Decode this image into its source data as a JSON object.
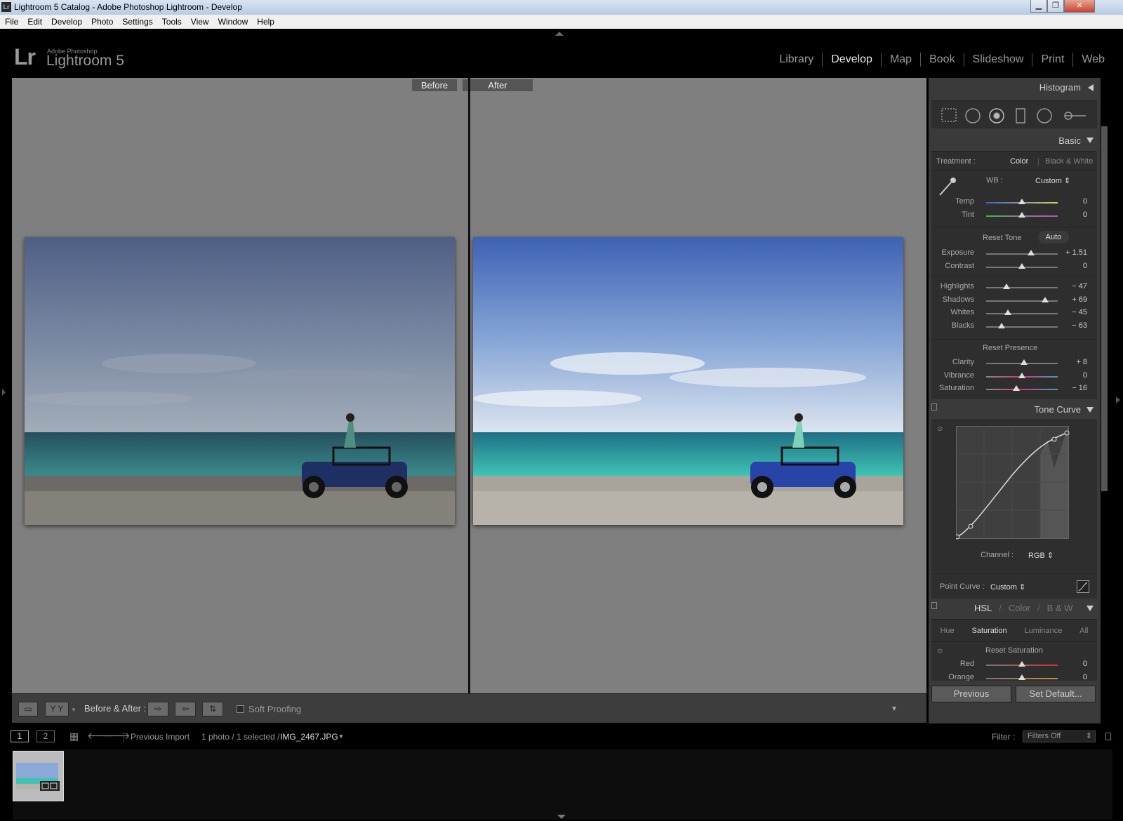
{
  "window": {
    "title": "Lightroom 5 Catalog - Adobe Photoshop Lightroom - Develop",
    "icon_label": "Lr",
    "min_icon": "minimize-icon",
    "max_icon": "maximize-icon",
    "close_icon": "close-icon"
  },
  "menu": [
    "File",
    "Edit",
    "Develop",
    "Photo",
    "Settings",
    "Tools",
    "View",
    "Window",
    "Help"
  ],
  "identity": {
    "logo": "Lr",
    "brand": "Adobe Photoshop",
    "product": "Lightroom 5"
  },
  "modules": [
    "Library",
    "Develop",
    "Map",
    "Book",
    "Slideshow",
    "Print",
    "Web"
  ],
  "active_module": "Develop",
  "compare": {
    "before_label": "Before",
    "after_label": "After"
  },
  "toolbar": {
    "before_after_label": "Before & After :",
    "soft_proofing": "Soft Proofing",
    "yy_label": "Y Y"
  },
  "panels": {
    "histogram": "Histogram",
    "basic": {
      "title": "Basic",
      "treatment_label": "Treatment :",
      "treatment_color": "Color",
      "treatment_bw": "Black & White",
      "wb_label": "WB :",
      "wb_value": "Custom",
      "reset_tone": "Reset Tone",
      "auto": "Auto",
      "reset_presence": "Reset Presence",
      "wb_sliders": [
        {
          "label": "Temp",
          "value": "0",
          "pos": 0.5
        },
        {
          "label": "Tint",
          "value": "0",
          "pos": 0.5
        }
      ],
      "tone_sliders": [
        {
          "label": "Exposure",
          "value": "+ 1.51",
          "pos": 0.63
        },
        {
          "label": "Contrast",
          "value": "0",
          "pos": 0.5
        }
      ],
      "tone2_sliders": [
        {
          "label": "Highlights",
          "value": "− 47",
          "pos": 0.28
        },
        {
          "label": "Shadows",
          "value": "+ 69",
          "pos": 0.82
        },
        {
          "label": "Whites",
          "value": "− 45",
          "pos": 0.3
        },
        {
          "label": "Blacks",
          "value": "− 63",
          "pos": 0.22
        }
      ],
      "presence_sliders": [
        {
          "label": "Clarity",
          "value": "+ 8",
          "pos": 0.53
        },
        {
          "label": "Vibrance",
          "value": "0",
          "pos": 0.5
        },
        {
          "label": "Saturation",
          "value": "− 16",
          "pos": 0.42
        }
      ]
    },
    "tone_curve": {
      "title": "Tone Curve",
      "channel_label": "Channel :",
      "channel_value": "RGB",
      "point_curve_label": "Point Curve :",
      "point_curve_value": "Custom"
    },
    "hsl": {
      "hsl": "HSL",
      "color": "Color",
      "bw": "B & W",
      "tabs": [
        "Hue",
        "Saturation",
        "Luminance",
        "All"
      ],
      "active_tab": "Saturation",
      "reset": "Reset Saturation",
      "sliders": [
        {
          "label": "Red",
          "value": "0",
          "pos": 0.5
        },
        {
          "label": "Orange",
          "value": "0",
          "pos": 0.5
        }
      ]
    },
    "previous_button": "Previous",
    "set_default_button": "Set Default..."
  },
  "filmstrip": {
    "page1": "1",
    "page2": "2",
    "source": "Previous Import",
    "count": "1 photo / 1 selected /",
    "filename": "IMG_2467.JPG",
    "filter_label": "Filter :",
    "filter_value": "Filters Off"
  },
  "colors": {
    "accent": "#e8e8e8",
    "panel": "#3a3a3a",
    "canvas": "#7f7f7f"
  }
}
